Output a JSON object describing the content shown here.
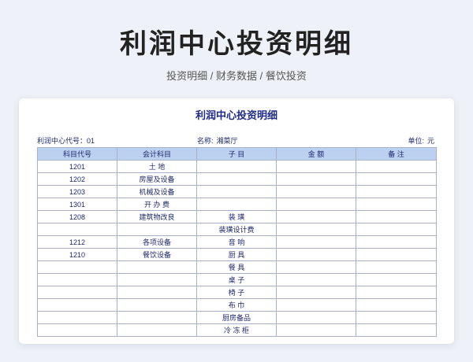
{
  "header": {
    "title": "利润中心投资明细",
    "subtitle": "投资明细 / 财务数据 / 餐饮投资"
  },
  "document": {
    "title": "利润中心投资明细",
    "center_code_label": "利润中心代号：",
    "center_code_value": "01",
    "name_label": "名称:",
    "name_value": "湘菜厅",
    "unit_label": "单位:",
    "unit_value": "元",
    "columns": [
      "科目代号",
      "会计科目",
      "子  目",
      "金  额",
      "备  注"
    ],
    "rows": [
      [
        "1201",
        "土    地",
        "",
        "",
        ""
      ],
      [
        "1202",
        "房屋及设备",
        "",
        "",
        ""
      ],
      [
        "1203",
        "机械及设备",
        "",
        "",
        ""
      ],
      [
        "1301",
        "开 办 费",
        "",
        "",
        ""
      ],
      [
        "1208",
        "建筑物改良",
        "装    璜",
        "",
        ""
      ],
      [
        "",
        "",
        "装璜设计费",
        "",
        ""
      ],
      [
        "1212",
        "各项设备",
        "音    响",
        "",
        ""
      ],
      [
        "1210",
        "餐饮设备",
        "厨    具",
        "",
        ""
      ],
      [
        "",
        "",
        "餐    具",
        "",
        ""
      ],
      [
        "",
        "",
        "桌    子",
        "",
        ""
      ],
      [
        "",
        "",
        "椅    子",
        "",
        ""
      ],
      [
        "",
        "",
        "布    巾",
        "",
        ""
      ],
      [
        "",
        "",
        "厨房备品",
        "",
        ""
      ],
      [
        "",
        "",
        "冷 冻 柜",
        "",
        ""
      ]
    ]
  },
  "colors": {
    "background": "#eef1f7",
    "title_text": "#222222",
    "doc_title": "#1f2a8a",
    "table_text": "#1f2a6e",
    "header_fill": "#bcd0f0",
    "grid_line": "#a7b1c8"
  }
}
